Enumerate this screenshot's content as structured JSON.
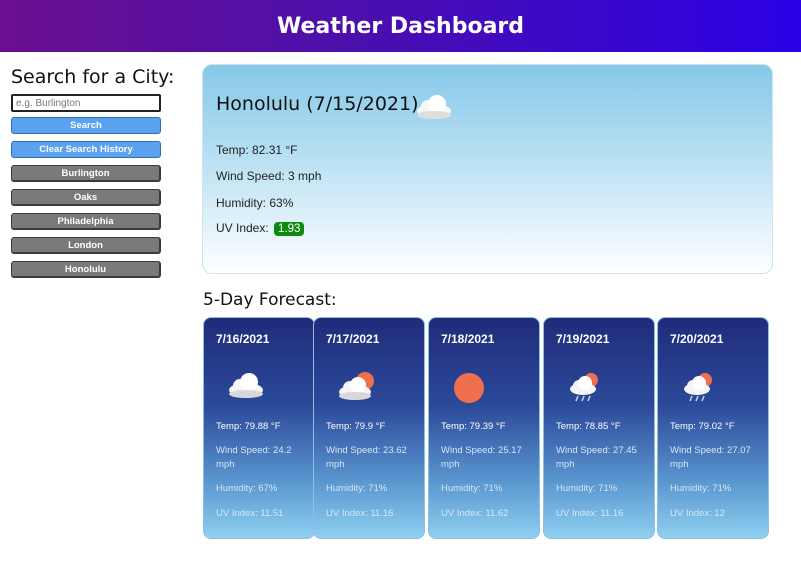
{
  "header": {
    "title": "Weather Dashboard"
  },
  "sidebar": {
    "title": "Search for a City:",
    "search_placeholder": "e.g. Burlington",
    "search_label": "Search",
    "clear_label": "Clear Search History",
    "history": [
      "Burlington",
      "Oaks",
      "Philadelphia",
      "London",
      "Honolulu"
    ]
  },
  "current": {
    "city_date": "Honolulu (7/15/2021)",
    "icon": "cloud-icon",
    "temp": "Temp: 82.31 °F",
    "wind": "Wind Speed: 3 mph",
    "humidity": "Humidity: 63%",
    "uv_label": "UV Index:",
    "uv_value": "1.93",
    "uv_color": "#0e8a0e"
  },
  "forecast": {
    "title": "5-Day Forecast:",
    "days": [
      {
        "date": "7/16/2021",
        "icon": "cloud-icon",
        "temp": "Temp: 79.88 °F",
        "wind": "Wind Speed: 24.2 mph",
        "humidity": "Humidity: 67%",
        "uv": "UV Index: 11.51"
      },
      {
        "date": "7/17/2021",
        "icon": "sun-behind-cloud-icon",
        "temp": "Temp: 79.9 °F",
        "wind": "Wind Speed: 23.62 mph",
        "humidity": "Humidity: 71%",
        "uv": "UV Index: 11.16"
      },
      {
        "date": "7/18/2021",
        "icon": "sun-icon",
        "temp": "Temp: 79.39 °F",
        "wind": "Wind Speed: 25.17 mph",
        "humidity": "Humidity: 71%",
        "uv": "UV Index: 11.62"
      },
      {
        "date": "7/19/2021",
        "icon": "sun-cloud-rain-icon",
        "temp": "Temp: 78.85 °F",
        "wind": "Wind Speed: 27.45 mph",
        "humidity": "Humidity: 71%",
        "uv": "UV Index: 11.16"
      },
      {
        "date": "7/20/2021",
        "icon": "sun-cloud-rain-icon",
        "temp": "Temp: 79.02 °F",
        "wind": "Wind Speed: 27.07 mph",
        "humidity": "Humidity: 71%",
        "uv": "UV Index: 12"
      }
    ]
  }
}
